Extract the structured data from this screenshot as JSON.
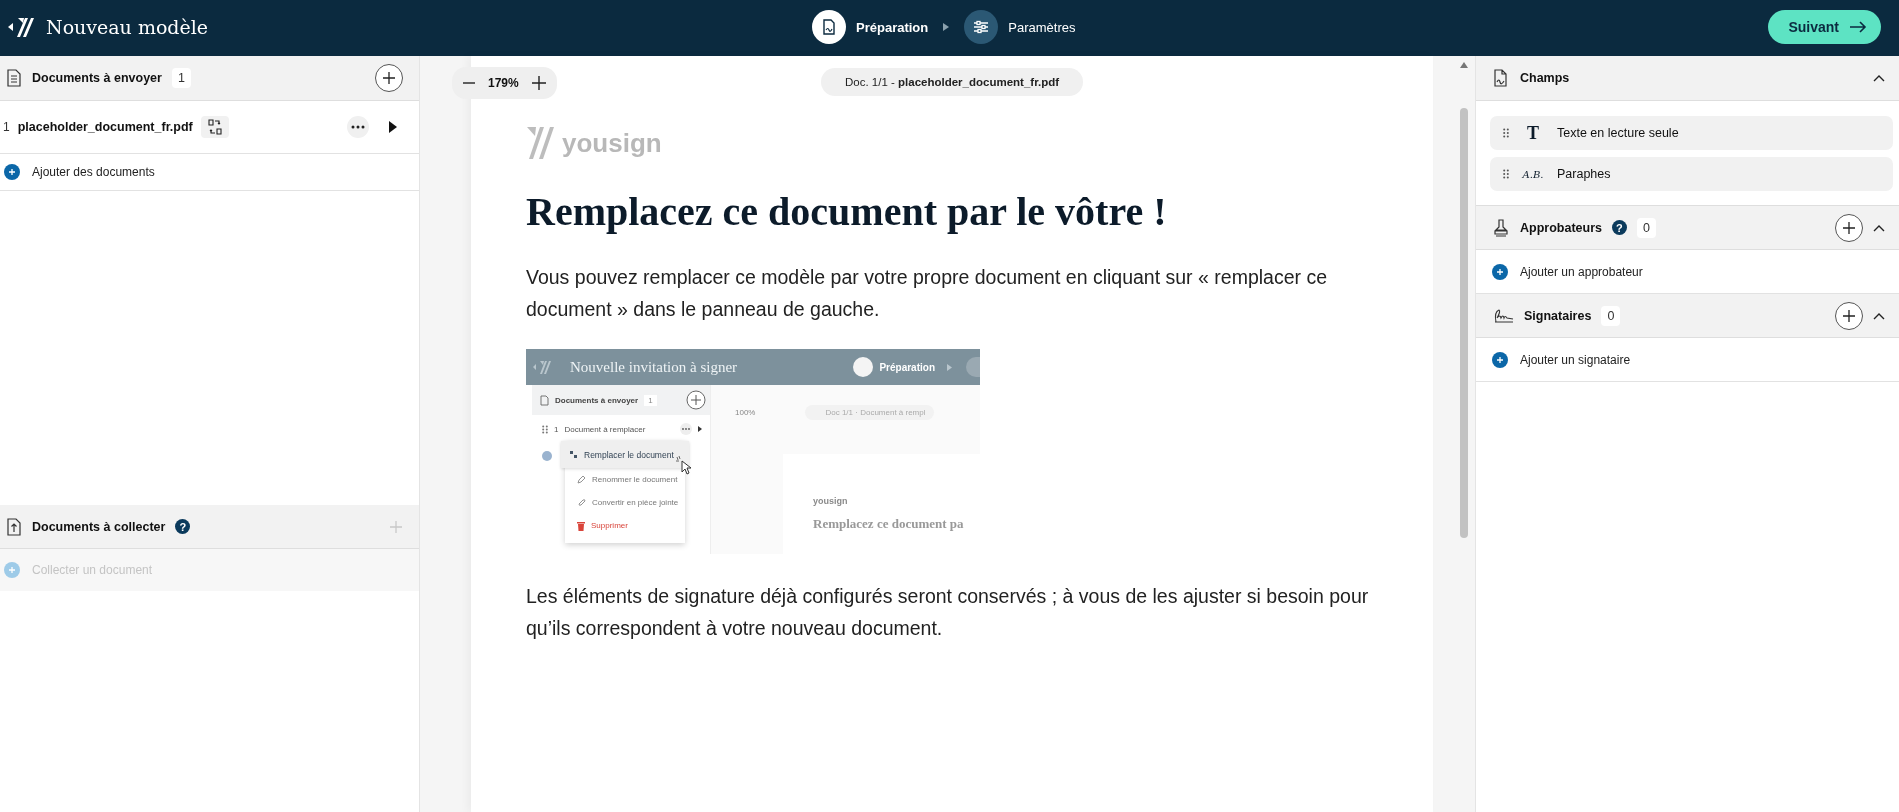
{
  "header": {
    "title": "Nouveau modèle",
    "steps": [
      {
        "label": "Préparation",
        "kind": "preparation",
        "selected": true
      },
      {
        "label": "Paramètres",
        "kind": "settings",
        "selected": false
      }
    ],
    "next_button": "Suivant"
  },
  "left_panel": {
    "send_section": {
      "title": "Documents à envoyer",
      "count": "1",
      "documents": [
        {
          "index": "1",
          "name": "placeholder_document_fr.pdf"
        }
      ],
      "add_link": "Ajouter des documents"
    },
    "collect_section": {
      "title": "Documents à collecter",
      "help": "?",
      "disabled": true,
      "add_link": "Collecter un document"
    }
  },
  "viewer": {
    "zoom": "179%",
    "doc_label": "Doc. 1/1 - **placeholder_document_fr.pdf**",
    "page": {
      "logo": "yousign",
      "heading": "Remplacez ce document par le vôtre !",
      "paragraphs": [
        "Vous pouvez remplacer ce modèle par votre propre document en cliquant sur « remplacer ce document » dans le panneau de gauche.",
        "Les éléments de signature déjà configurés seront conservés ; à vous de les ajuster si besoin pour qu’ils correspondent à votre nouveau document."
      ],
      "illustration": {
        "title": "Nouvelle invitation à signer",
        "step": "Préparation",
        "section_title": "Documents à envoyer",
        "count": "1",
        "doc_index": "1",
        "doc_name": "Document à remplacer",
        "zoom": "100%",
        "doc_label": "Doc 1/1 · Document à rempl",
        "logo": "yousign",
        "heading": "Remplacez ce document pa",
        "menu": [
          {
            "label": "Remplacer le document",
            "kind": "replace",
            "selected": true
          },
          {
            "label": "Renommer le document",
            "kind": "rename",
            "selected": false
          },
          {
            "label": "Convertir en pièce jointe",
            "kind": "attach",
            "selected": false
          },
          {
            "label": "Supprimer",
            "kind": "delete",
            "selected": false
          }
        ]
      }
    }
  },
  "right_panel": {
    "fields_section": {
      "title": "Champs",
      "expanded": true,
      "fields": [
        {
          "kind": "text",
          "glyph": "T",
          "label": "Texte en lecture seule"
        },
        {
          "kind": "initials",
          "glyph": "A.B.",
          "label": "Paraphes"
        }
      ]
    },
    "approvers_section": {
      "title": "Approbateurs",
      "help": "?",
      "count": "0",
      "expanded": true,
      "add_link": "Ajouter un approbateur"
    },
    "signers_section": {
      "title": "Signataires",
      "count": "0",
      "expanded": true,
      "add_link": "Ajouter un signataire"
    }
  }
}
